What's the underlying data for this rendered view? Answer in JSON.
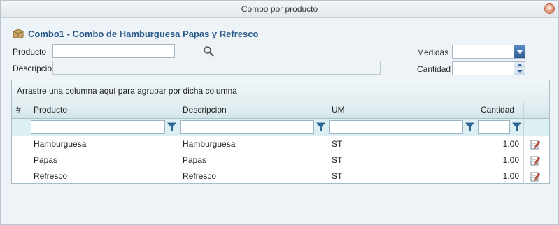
{
  "window": {
    "title": "Combo por producto"
  },
  "header": {
    "title": "Combo1 - Combo de Hamburguesa Papas y Refresco"
  },
  "form": {
    "producto_label": "Producto",
    "producto_value": "",
    "descripcion_label": "Descripcion",
    "descripcion_value": "",
    "medidas_label": "Medidas",
    "medidas_value": "",
    "cantidad_label": "Cantidad",
    "cantidad_value": ""
  },
  "grid": {
    "group_prompt": "Arrastre una columna aquí para agrupar por dicha columna",
    "columns": [
      "#",
      "Producto",
      "Descripcion",
      "UM",
      "Cantidad"
    ],
    "rows": [
      {
        "num": "",
        "producto": "Hamburguesa",
        "descripcion": "Hamburguesa",
        "um": "ST",
        "cantidad": "1.00"
      },
      {
        "num": "",
        "producto": "Papas",
        "descripcion": "Papas",
        "um": "ST",
        "cantidad": "1.00"
      },
      {
        "num": "",
        "producto": "Refresco",
        "descripcion": "Refresco",
        "um": "ST",
        "cantidad": "1.00"
      }
    ]
  },
  "icons": {
    "close": "close-icon",
    "product": "package-icon",
    "search": "search-icon",
    "filter": "filter-icon",
    "edit": "edit-icon"
  },
  "colors": {
    "title_text": "#2a5a8a",
    "accent": "#2f5f97",
    "grid_header": "#d4e5ea"
  }
}
